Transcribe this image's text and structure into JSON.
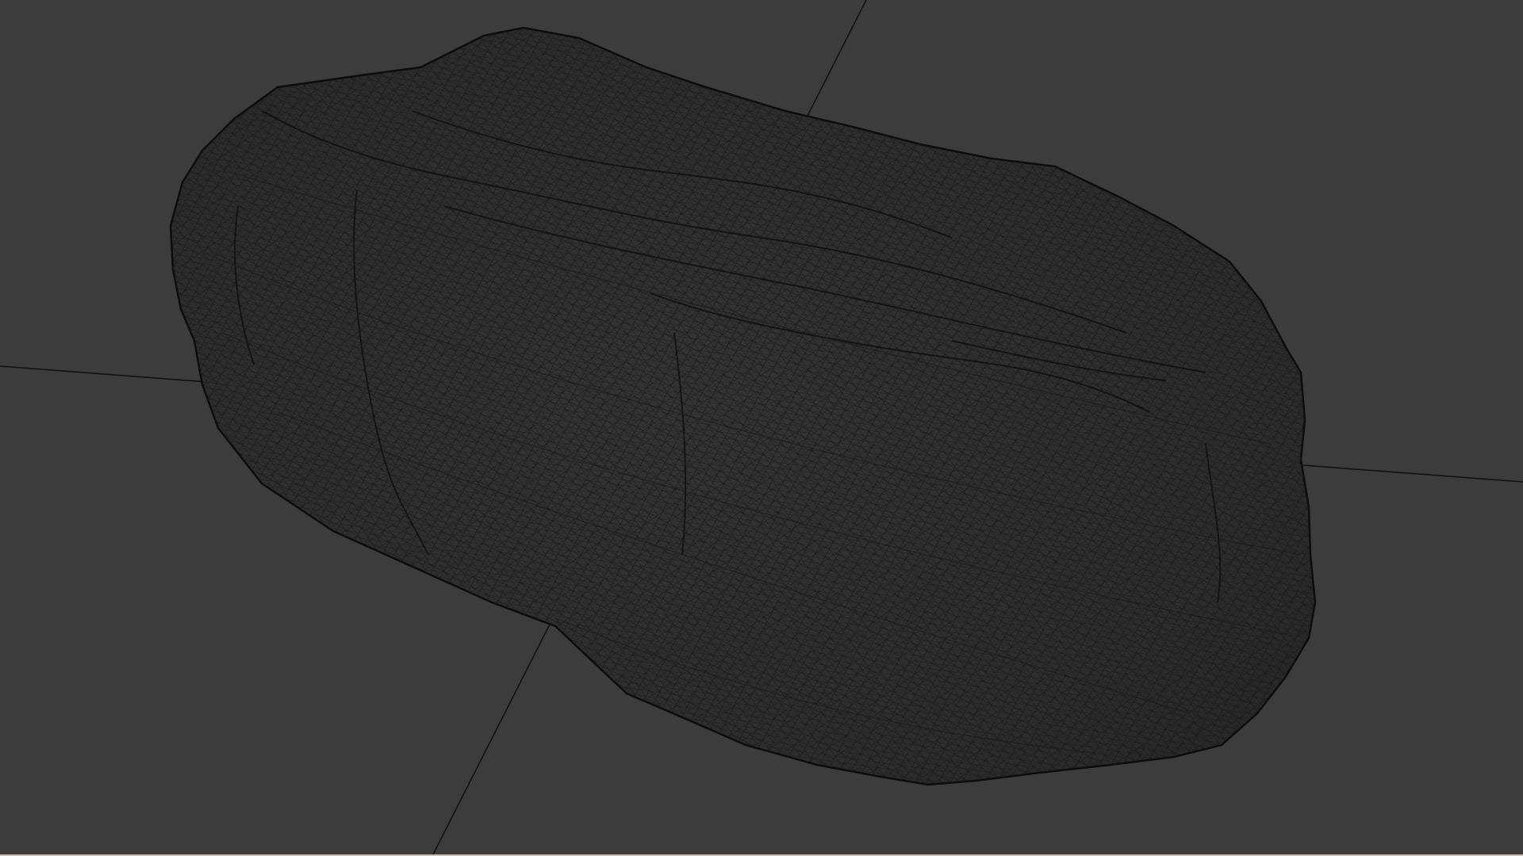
{
  "viewport": {
    "object": "rock-mesh",
    "display_mode": "wireframe",
    "background_color": "#3c3c3c",
    "mesh_color": "#151515",
    "axis_color": "#121212"
  },
  "icons": {
    "mesh": "wireframe-mesh-icon"
  }
}
